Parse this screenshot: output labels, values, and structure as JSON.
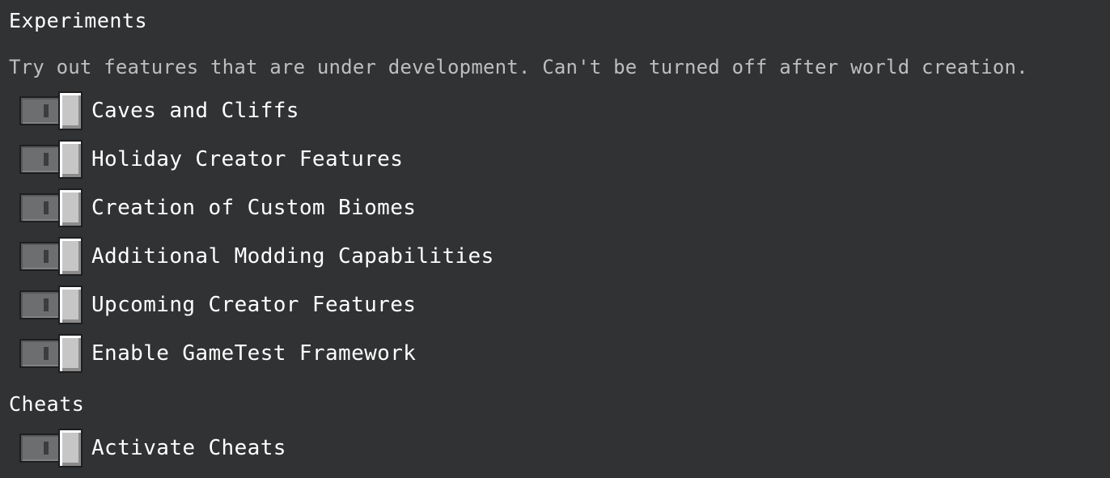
{
  "experiments": {
    "title": "Experiments",
    "description": "Try out features that are under development. Can't be turned off after world creation.",
    "toggles": [
      {
        "label": "Caves and Cliffs",
        "state": "off"
      },
      {
        "label": "Holiday Creator Features",
        "state": "off"
      },
      {
        "label": "Creation of Custom Biomes",
        "state": "off"
      },
      {
        "label": "Additional Modding Capabilities",
        "state": "off"
      },
      {
        "label": "Upcoming Creator Features",
        "state": "off"
      },
      {
        "label": "Enable GameTest Framework",
        "state": "off"
      }
    ]
  },
  "cheats": {
    "title": "Cheats",
    "toggles": [
      {
        "label": "Activate Cheats",
        "state": "off"
      }
    ]
  },
  "colors": {
    "background": "#313233",
    "text": "#ffffff",
    "description_text": "#bcbec0",
    "toggle_track": "#6d6e70",
    "toggle_knob": "#c6c6c6"
  },
  "icons": {
    "toggle": "toggle-switch-off"
  }
}
